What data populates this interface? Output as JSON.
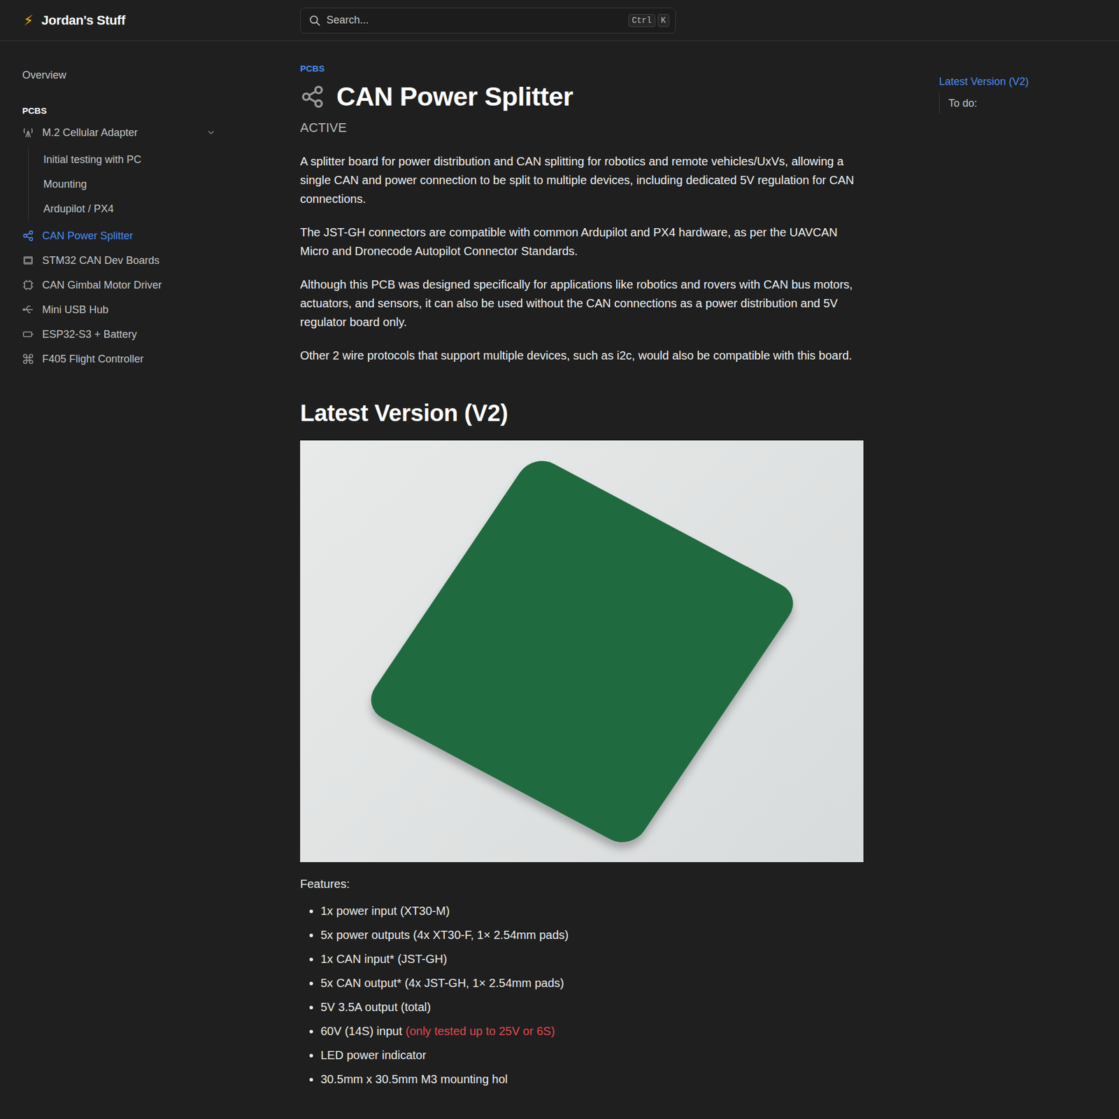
{
  "header": {
    "logo_icon": "⚡",
    "title": "Jordan's Stuff",
    "search": {
      "placeholder": "Search...",
      "keys": [
        "Ctrl",
        "K"
      ]
    }
  },
  "sidebar": {
    "overview": "Overview",
    "section": "PCBS",
    "items": [
      {
        "label": "M.2 Cellular Adapter",
        "selected": false,
        "expanded": true,
        "children": [
          {
            "label": "Initial testing with PC",
            "selected": false
          },
          {
            "label": "Mounting",
            "selected": false
          },
          {
            "label": "Ardupilot / PX4",
            "selected": false
          }
        ]
      },
      {
        "label": "CAN Power Splitter",
        "selected": true,
        "expanded": false,
        "children": []
      },
      {
        "label": "STM32 CAN Dev Boards",
        "selected": false,
        "expanded": false,
        "children": []
      },
      {
        "label": "CAN Gimbal Motor Driver",
        "selected": false,
        "expanded": false,
        "children": []
      },
      {
        "label": "Mini USB Hub",
        "selected": false,
        "expanded": false,
        "children": []
      },
      {
        "label": "ESP32-S3 + Battery",
        "selected": false,
        "expanded": false,
        "children": []
      },
      {
        "label": "F405 Flight Controller",
        "selected": false,
        "expanded": false,
        "children": []
      }
    ]
  },
  "page": {
    "category": "PCBS",
    "title": "CAN Power Splitter",
    "status": "ACTIVE",
    "paragraphs": [
      "A splitter board for power distribution and CAN splitting for robotics and remote vehicles/UxVs, allowing a single CAN and power connection to be split to multiple devices, including dedicated 5V regulation for CAN connections.",
      "The JST-GH connectors are compatible with common Ardupilot and PX4 hardware, as per the UAVCAN Micro and Dronecode Autopilot Connector Standards.",
      "Although this PCB was designed specifically for applications like robotics and rovers with CAN bus motors, actuators, and sensors, it can also be used without the CAN connections as a power distribution and 5V regulator board only.",
      "Other 2 wire protocols that support multiple devices, such as i2c, would also be compatible with this board."
    ],
    "section_title": "Latest Version (V2)",
    "features_label": "Features:",
    "features": [
      {
        "text": "1x power input (XT30-M)",
        "note": ""
      },
      {
        "text": "5x power outputs (4x XT30-F, 1× 2.54mm pads)",
        "note": ""
      },
      {
        "text": "1x CAN input* (JST-GH)",
        "note": ""
      },
      {
        "text": "5x CAN output* (4x JST-GH, 1× 2.54mm pads)",
        "note": ""
      },
      {
        "text": "5V 3.5A output (total)",
        "note": ""
      },
      {
        "text": "60V (14S) input",
        "note": "(only tested up to 25V or 6S)"
      },
      {
        "text": "LED power indicator",
        "note": ""
      },
      {
        "text": "30.5mm x 30.5mm M3 mounting hol",
        "note": ""
      }
    ]
  },
  "toc": [
    {
      "label": "Latest Version (V2)",
      "selected": true
    },
    {
      "label": "To do:",
      "selected": false
    }
  ]
}
